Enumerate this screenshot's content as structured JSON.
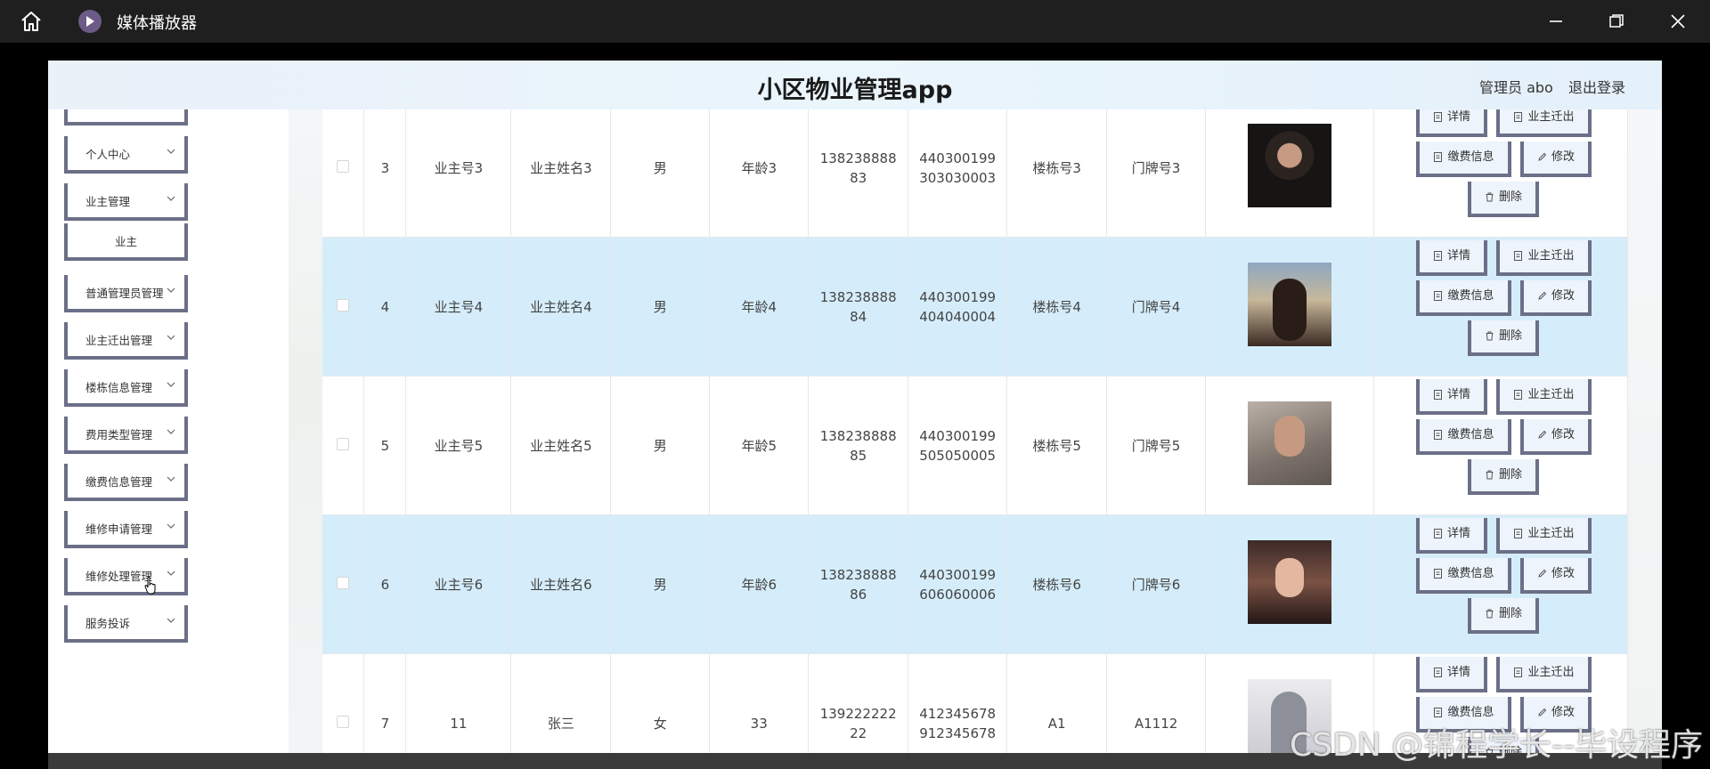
{
  "player": {
    "title": "媒体播放器"
  },
  "app": {
    "title": "小区物业管理app",
    "admin": "管理员 abo",
    "logout": "退出登录"
  },
  "sidebar": {
    "items": [
      {
        "label": ""
      },
      {
        "label": "个人中心"
      },
      {
        "label": "业主管理"
      },
      {
        "label": "业主"
      },
      {
        "label": "普通管理员管理"
      },
      {
        "label": "业主迁出管理"
      },
      {
        "label": "楼栋信息管理"
      },
      {
        "label": "费用类型管理"
      },
      {
        "label": "缴费信息管理"
      },
      {
        "label": "维修申请管理"
      },
      {
        "label": "维修处理管理"
      },
      {
        "label": "服务投诉"
      }
    ]
  },
  "actions": {
    "detail": "详情",
    "move_out": "业主迁出",
    "fee": "缴费信息",
    "edit": "修改",
    "delete": "删除"
  },
  "rows": [
    {
      "index": "3",
      "owner_no": "业主号3",
      "name": "业主姓名3",
      "gender": "男",
      "age": "年龄3",
      "phone": "13823888883",
      "id_card": "440300199303030003",
      "building": "楼栋号3",
      "door": "门牌号3",
      "photo": "photo-male-dark"
    },
    {
      "index": "4",
      "owner_no": "业主号4",
      "name": "业主姓名4",
      "gender": "男",
      "age": "年龄4",
      "phone": "13823888884",
      "id_card": "440300199404040004",
      "building": "楼栋号4",
      "door": "门牌号4",
      "photo": "photo-female-street"
    },
    {
      "index": "5",
      "owner_no": "业主号5",
      "name": "业主姓名5",
      "gender": "男",
      "age": "年龄5",
      "phone": "13823888885",
      "id_card": "440300199505050005",
      "building": "楼栋号5",
      "door": "门牌号5",
      "photo": "photo-male-selfie"
    },
    {
      "index": "6",
      "owner_no": "业主号6",
      "name": "业主姓名6",
      "gender": "男",
      "age": "年龄6",
      "phone": "13823888886",
      "id_card": "440300199606060006",
      "building": "楼栋号6",
      "door": "门牌号6",
      "photo": "photo-female-portrait"
    },
    {
      "index": "7",
      "owner_no": "11",
      "name": "张三",
      "gender": "女",
      "age": "33",
      "phone": "13922222222",
      "id_card": "412345678912345678",
      "building": "A1",
      "door": "A1112",
      "photo": "photo-anime-character"
    }
  ],
  "watermark": "CSDN @锦程学长--毕设程序",
  "colors": {
    "highlight_row": "#d5edfa",
    "button_border": "#6b6f87",
    "header_bg": "#eaf5fc"
  }
}
